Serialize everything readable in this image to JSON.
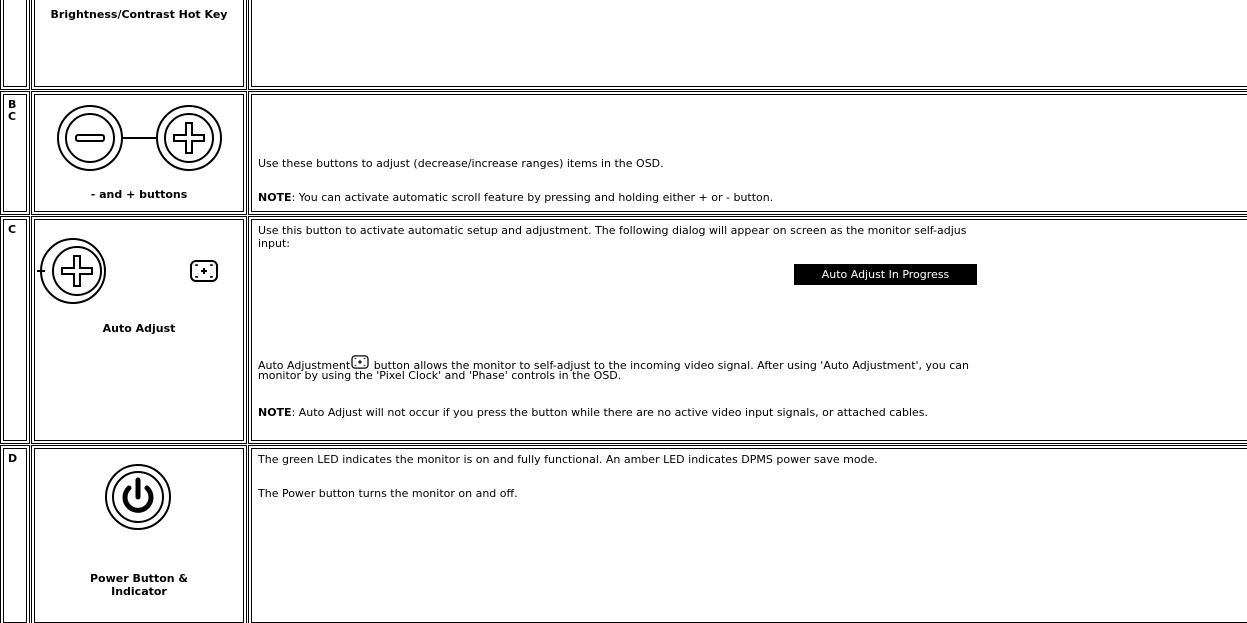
{
  "rows": [
    {
      "id": "brightness",
      "letters": "",
      "label": "Brightness/Contrast Hot Key"
    },
    {
      "id": "minus-plus",
      "letters": "B\nC",
      "label": "- and + buttons",
      "text": {
        "p1": "Use these buttons to adjust (decrease/increase ranges) items in the OSD.",
        "note_label": "NOTE",
        "note_text": ": You can activate automatic scroll feature by pressing and holding either + or - button."
      }
    },
    {
      "id": "auto-adjust",
      "letters": "C",
      "label": "Auto Adjust",
      "text": {
        "p1a": "Use this button to activate automatic setup and adjustment. The following dialog will appear on screen as the monitor self-adjus",
        "p1b": "input:",
        "banner": "Auto Adjust In Progress",
        "p2a_before": "Auto Adjustment",
        "p2a_after": " button allows the monitor to self-adjust to the incoming video signal. After using 'Auto Adjustment', you can",
        "p2b": "monitor by using the 'Pixel Clock' and 'Phase' controls in the OSD.",
        "note_label": "NOTE",
        "note_text": ": Auto Adjust will not occur if you press the button while there are no active video input signals, or attached cables."
      }
    },
    {
      "id": "power",
      "letters": "D",
      "label_line1": "Power Button &",
      "label_line2": "Indicator",
      "text": {
        "p1": "The green LED indicates the monitor is on and fully functional. An amber LED indicates DPMS power save mode.",
        "p2": "The Power button turns the monitor on and off."
      }
    }
  ]
}
